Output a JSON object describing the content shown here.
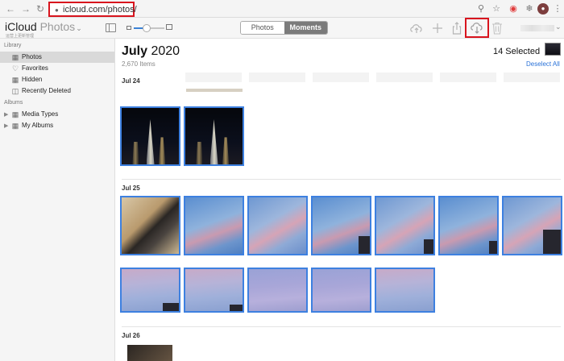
{
  "browser": {
    "url": "icloud.com/photos/"
  },
  "app": {
    "brand": "iCloud",
    "brand_sub": "Photos",
    "brand_tag": "运营上更新管理",
    "view_tabs": [
      "Photos",
      "Moments"
    ],
    "active_view": "Moments"
  },
  "sidebar": {
    "library_label": "Library",
    "library_items": [
      {
        "label": "Photos",
        "icon": "photos-icon",
        "active": true
      },
      {
        "label": "Favorites",
        "icon": "heart-icon",
        "active": false
      },
      {
        "label": "Hidden",
        "icon": "hidden-icon",
        "active": false
      },
      {
        "label": "Recently Deleted",
        "icon": "trash-icon",
        "active": false
      }
    ],
    "albums_label": "Albums",
    "album_items": [
      {
        "label": "Media Types",
        "icon": "folder-icon"
      },
      {
        "label": "My Albums",
        "icon": "folder-icon"
      }
    ]
  },
  "main": {
    "month": "July",
    "year": "2020",
    "photo_count": "2,670 Items",
    "selected": "14 Selected",
    "deselect": "Deselect All",
    "days": [
      "Jul 24",
      "Jul 25",
      "Jul 26"
    ]
  },
  "colors": {
    "accent": "#3d80e0",
    "highlight": "#d8141e",
    "link": "#2a72d8"
  }
}
